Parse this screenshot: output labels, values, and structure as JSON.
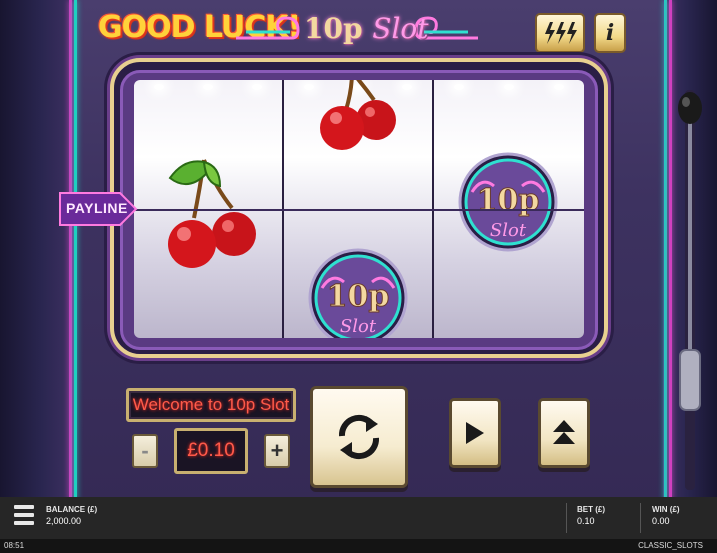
{
  "header": {
    "good_luck": "GOOD LUCK!",
    "logo_main": "10p",
    "logo_sub": "Slot",
    "turbo_icon": "lightning-icon",
    "info_label": "i"
  },
  "reels": [
    {
      "symbols": [
        "cherries",
        "cherries"
      ]
    },
    {
      "symbols": [
        "cherries",
        "10p-slot-logo"
      ]
    },
    {
      "symbols": [
        "10p-slot-logo"
      ]
    }
  ],
  "payline_label": "PAYLINE",
  "controls": {
    "message": "Welcome to 10p Slot",
    "minus_label": "-",
    "plus_label": "+",
    "bet_display": "£0.10",
    "spin_icon": "refresh-icon",
    "play_icon": "play-icon",
    "auto_icon": "eject-icon"
  },
  "bottom_bar": {
    "balance_label": "BALANCE (£)",
    "balance_value": "2,000.00",
    "bet_label": "BET (£)",
    "bet_value": "0.10",
    "win_label": "WIN (£)",
    "win_value": "0.00",
    "clock": "08:51",
    "game_name": "CLASSIC_SLOTS"
  },
  "colors": {
    "display_text": "#ff5a4a",
    "good_luck": "#ffd23a",
    "neon_teal": "#1fd0c0",
    "neon_pink": "#d040c0",
    "button_face": "#f6ecd0"
  }
}
